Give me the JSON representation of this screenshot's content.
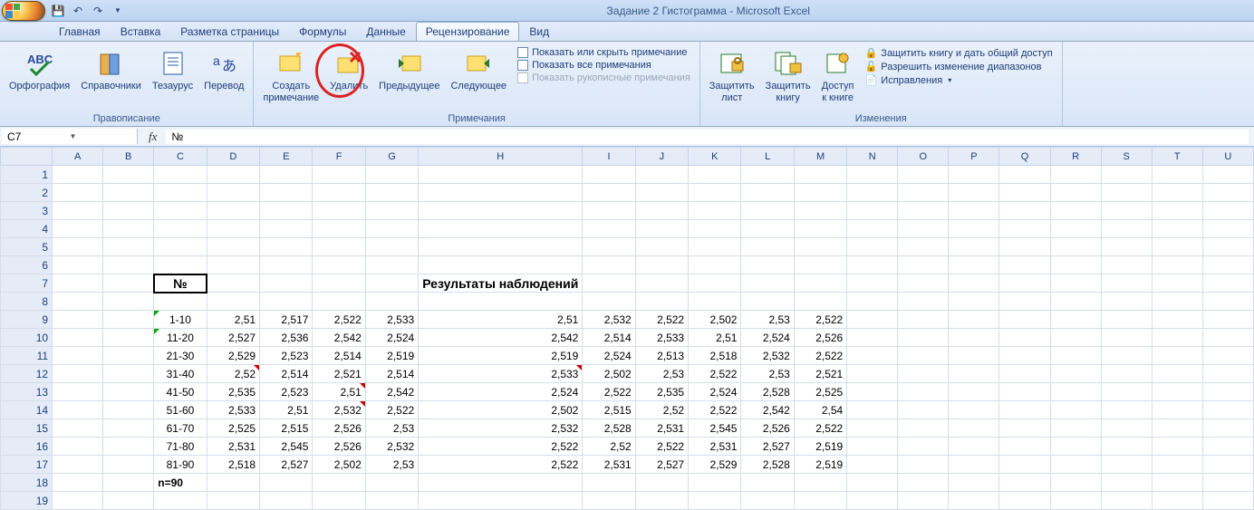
{
  "title": "Задание 2 Гистограмма - Microsoft Excel",
  "tabs": [
    "Главная",
    "Вставка",
    "Разметка страницы",
    "Формулы",
    "Данные",
    "Рецензирование",
    "Вид"
  ],
  "activeTab": 5,
  "groups": {
    "proofing": {
      "label": "Правописание",
      "spelling": "Орфография",
      "research": "Справочники",
      "thesaurus": "Тезаурус",
      "translate": "Перевод"
    },
    "comments": {
      "label": "Примечания",
      "new": "Создать\nпримечание",
      "delete": "Удалить",
      "previous": "Предыдущее",
      "next": "Следующее",
      "showhide": "Показать или скрыть примечание",
      "showall": "Показать все примечания",
      "ink": "Показать рукописные примечания"
    },
    "changes": {
      "label": "Изменения",
      "protectSheet": "Защитить\nлист",
      "protectBook": "Защитить\nкнигу",
      "shareBook": "Доступ\nк книге",
      "protectShare": "Защитить книгу и дать общий доступ",
      "allowRanges": "Разрешить изменение диапазонов",
      "track": "Исправления"
    }
  },
  "namebox": "C7",
  "formula": "№",
  "cols": [
    "A",
    "B",
    "C",
    "D",
    "E",
    "F",
    "G",
    "H",
    "I",
    "J",
    "K",
    "L",
    "M",
    "N",
    "O",
    "P",
    "Q",
    "R",
    "S",
    "T",
    "U"
  ],
  "header_title": "Результаты наблюдений",
  "header_col": "№",
  "rows": [
    {
      "r": 9,
      "lbl": "1-10",
      "v": [
        "2,51",
        "2,517",
        "2,522",
        "2,533",
        "2,51",
        "2,532",
        "2,522",
        "2,502",
        "2,53",
        "2,522"
      ]
    },
    {
      "r": 10,
      "lbl": "11-20",
      "v": [
        "2,527",
        "2,536",
        "2,542",
        "2,524",
        "2,542",
        "2,514",
        "2,533",
        "2,51",
        "2,524",
        "2,526"
      ]
    },
    {
      "r": 11,
      "lbl": "21-30",
      "v": [
        "2,529",
        "2,523",
        "2,514",
        "2,519",
        "2,519",
        "2,524",
        "2,513",
        "2,518",
        "2,532",
        "2,522"
      ]
    },
    {
      "r": 12,
      "lbl": "31-40",
      "v": [
        "2,52",
        "2,514",
        "2,521",
        "2,514",
        "2,533",
        "2,502",
        "2,53",
        "2,522",
        "2,53",
        "2,521"
      ]
    },
    {
      "r": 13,
      "lbl": "41-50",
      "v": [
        "2,535",
        "2,523",
        "2,51",
        "2,542",
        "2,524",
        "2,522",
        "2,535",
        "2,524",
        "2,528",
        "2,525"
      ]
    },
    {
      "r": 14,
      "lbl": "51-60",
      "v": [
        "2,533",
        "2,51",
        "2,532",
        "2,522",
        "2,502",
        "2,515",
        "2,52",
        "2,522",
        "2,542",
        "2,54"
      ]
    },
    {
      "r": 15,
      "lbl": "61-70",
      "v": [
        "2,525",
        "2,515",
        "2,526",
        "2,53",
        "2,532",
        "2,528",
        "2,531",
        "2,545",
        "2,526",
        "2,522"
      ]
    },
    {
      "r": 16,
      "lbl": "71-80",
      "v": [
        "2,531",
        "2,545",
        "2,526",
        "2,532",
        "2,522",
        "2,52",
        "2,522",
        "2,531",
        "2,527",
        "2,519"
      ]
    },
    {
      "r": 17,
      "lbl": "81-90",
      "v": [
        "2,518",
        "2,527",
        "2,502",
        "2,53",
        "2,522",
        "2,531",
        "2,527",
        "2,529",
        "2,528",
        "2,519"
      ]
    }
  ],
  "footer_lbl": "n=90"
}
